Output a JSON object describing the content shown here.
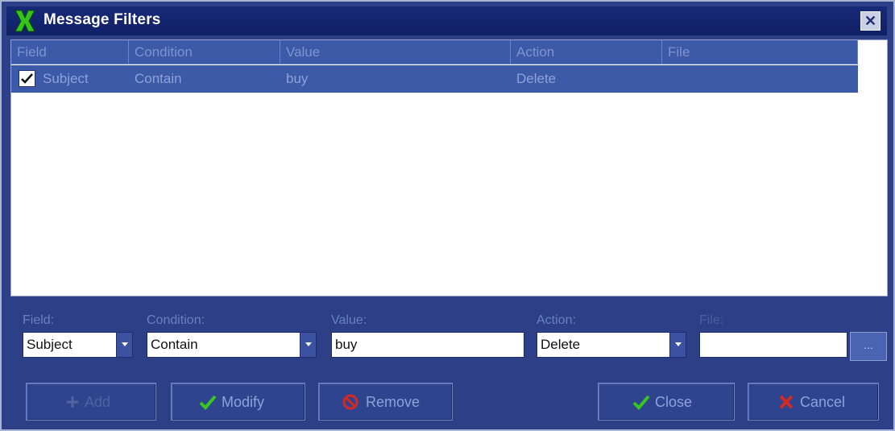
{
  "window": {
    "title": "Message Filters",
    "close_glyph": "✕"
  },
  "list": {
    "columns": [
      "Field",
      "Condition",
      "Value",
      "Action",
      "File"
    ],
    "rows": [
      {
        "checked": true,
        "field": "Subject",
        "condition": "Contain",
        "value": "buy",
        "action": "Delete",
        "file": ""
      }
    ]
  },
  "form": {
    "field_label": "Field:",
    "field_value": "Subject",
    "condition_label": "Condition:",
    "condition_value": "Contain",
    "value_label": "Value:",
    "value_value": "buy",
    "action_label": "Action:",
    "action_value": "Delete",
    "file_label": "File:",
    "file_value": "",
    "browse_label": "..."
  },
  "buttons": {
    "add": "Add",
    "modify": "Modify",
    "remove": "Remove",
    "close": "Close",
    "cancel": "Cancel"
  },
  "icons": {
    "app": "green-x-icon",
    "add": "plus-icon",
    "modify": "checkmark-icon",
    "remove": "no-sign-icon",
    "close": "checkmark-icon",
    "cancel": "red-x-icon"
  },
  "colors": {
    "window_bg": "#2d3f86",
    "titlebar_bg": "#172a78",
    "selection_bg": "#3d5aa8",
    "accent_green": "#37c51f",
    "accent_red": "#d42a22"
  }
}
